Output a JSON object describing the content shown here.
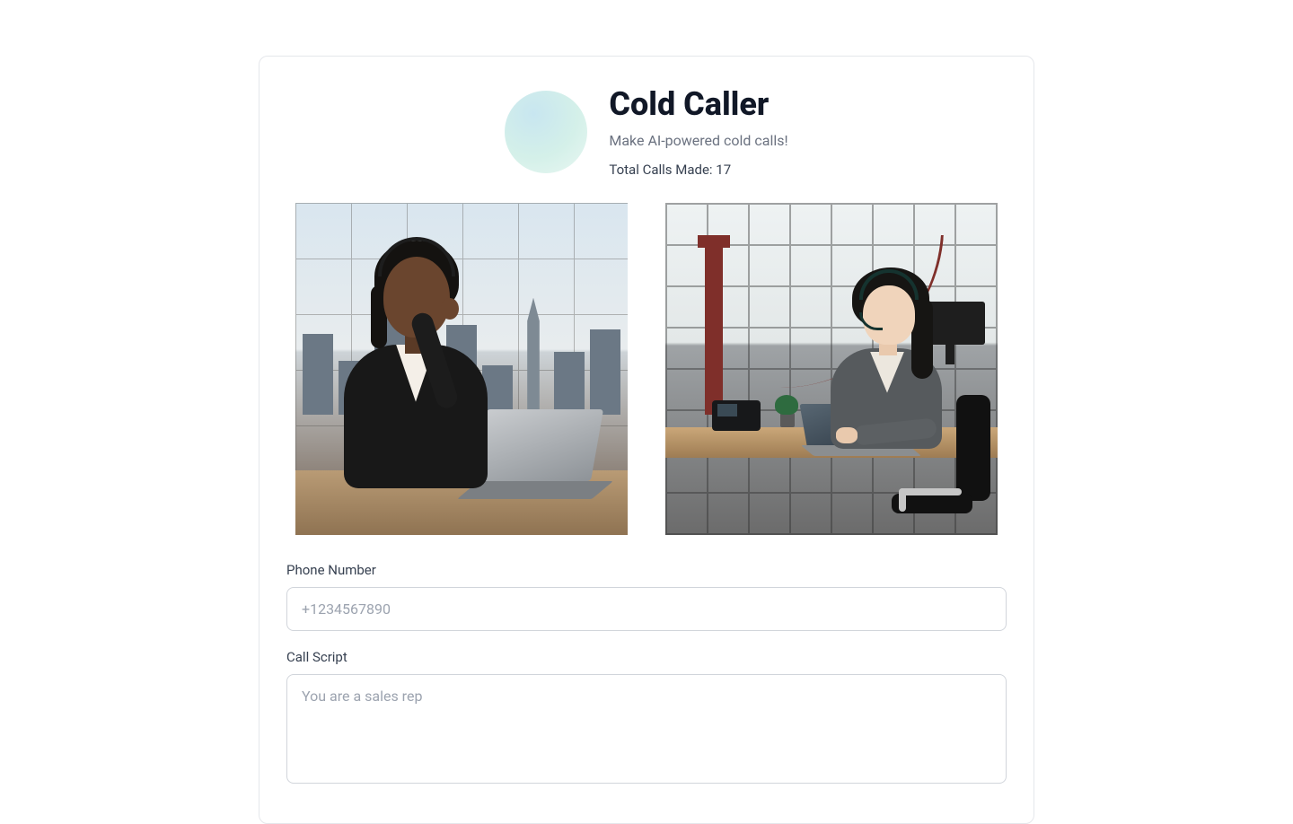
{
  "header": {
    "title": "Cold Caller",
    "subtitle": "Make AI-powered cold calls!",
    "stats_label": "Total Calls Made: 17"
  },
  "images": {
    "left_alt": "Sales representative with headset at laptop, city skyline",
    "right_alt": "Sales representative with headset at laptop, Golden Gate Bridge view"
  },
  "form": {
    "phone": {
      "label": "Phone Number",
      "placeholder": "+1234567890",
      "value": ""
    },
    "script": {
      "label": "Call Script",
      "placeholder": "You are a sales rep",
      "value": ""
    }
  }
}
